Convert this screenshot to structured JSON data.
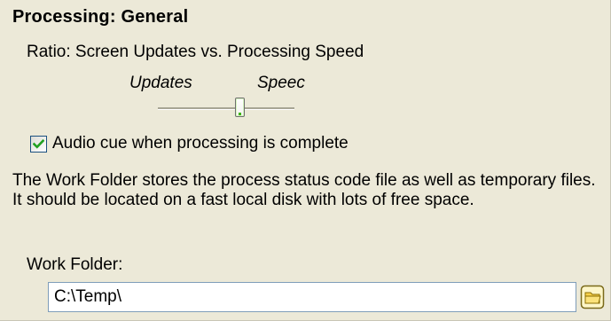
{
  "section": {
    "title": "Processing: General"
  },
  "ratio": {
    "label": "Ratio: Screen Updates vs. Processing Speed",
    "left_caption": "Updates",
    "right_caption": "Speec",
    "value_fraction": 0.6
  },
  "audio_cue": {
    "label": "Audio cue when processing is complete",
    "checked": true
  },
  "work_folder": {
    "description": "The Work Folder stores the process status code file as well as temporary files. It should be located on a fast local disk with lots of free space.",
    "label": "Work Folder:",
    "value": "C:\\Temp\\",
    "browse_icon": "folder-icon"
  },
  "colors": {
    "background": "#ece9d8",
    "checkmark": "#21a121",
    "slider_thumb_accent": "#3db515",
    "folder_yellow": "#f5d04a"
  }
}
